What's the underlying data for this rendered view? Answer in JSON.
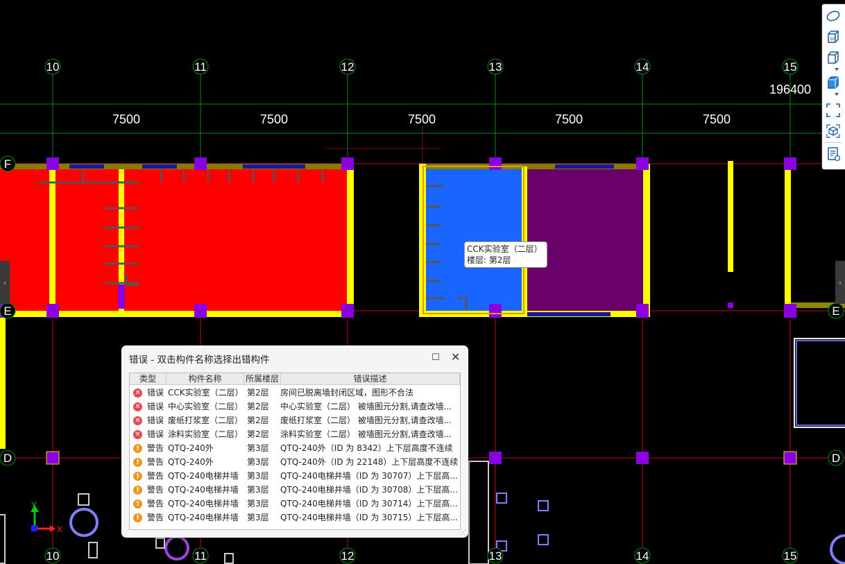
{
  "axes": {
    "columns_top": [
      "10",
      "11",
      "12",
      "13",
      "14",
      "15"
    ],
    "columns_bottom": [
      "10",
      "11",
      "12",
      "13",
      "14",
      "15"
    ],
    "rows_left": [
      "F",
      "E",
      "D"
    ],
    "rows_right": [
      "E",
      "D"
    ]
  },
  "dimensions": {
    "total": "196400",
    "spans": [
      "7500",
      "7500",
      "7500",
      "7500",
      "7500"
    ]
  },
  "tooltip": {
    "name": "CCK实验室（二层）",
    "floor": "楼层: 第2层"
  },
  "dialog": {
    "title": "错误 - 双击构件名称选择出错构件",
    "columns": [
      "类型",
      "构件名称",
      "所属楼层",
      "错误描述"
    ],
    "rows": [
      {
        "level": "error",
        "type": "错误",
        "name": "CCK实验室（二层）",
        "floor": "第2层",
        "desc": "房间已脱离墙封闭区域，图形不合法"
      },
      {
        "level": "error",
        "type": "错误",
        "name": "中心实验室（二层）",
        "floor": "第2层",
        "desc": "中心实验室（二层） 被墙图元分割,请查改墙..."
      },
      {
        "level": "error",
        "type": "错误",
        "name": "废纸打浆室（二层）",
        "floor": "第2层",
        "desc": "废纸打浆室（二层） 被墙图元分割,请查改墙..."
      },
      {
        "level": "error",
        "type": "错误",
        "name": "涂料实验室（二层）",
        "floor": "第2层",
        "desc": "涂料实验室（二层） 被墙图元分割,请查改墙..."
      },
      {
        "level": "warn",
        "type": "警告",
        "name": "QTQ-240外",
        "floor": "第3层",
        "desc": "QTQ-240外（ID 为 8342）上下层高度不连续"
      },
      {
        "level": "warn",
        "type": "警告",
        "name": "QTQ-240外",
        "floor": "第3层",
        "desc": "QTQ-240外（ID 为 22148）上下层高度不连续"
      },
      {
        "level": "warn",
        "type": "警告",
        "name": "QTQ-240电梯井墙",
        "floor": "第3层",
        "desc": "QTQ-240电梯井墙（ID 为 30707）上下层高..."
      },
      {
        "level": "warn",
        "type": "警告",
        "name": "QTQ-240电梯井墙",
        "floor": "第3层",
        "desc": "QTQ-240电梯井墙（ID 为 30708）上下层高..."
      },
      {
        "level": "warn",
        "type": "警告",
        "name": "QTQ-240电梯井墙",
        "floor": "第3层",
        "desc": "QTQ-240电梯井墙（ID 为 30714）上下层高..."
      },
      {
        "level": "warn",
        "type": "警告",
        "name": "QTQ-240电梯井墙",
        "floor": "第3层",
        "desc": "QTQ-240电梯井墙（ID 为 30715）上下层高..."
      }
    ]
  },
  "coord": {
    "y_label": "Y",
    "x_label": "X"
  },
  "toolbar": [
    "view-sphere-icon",
    "view-3d-icon",
    "box-view-icon",
    "solid-box-icon",
    "fit-view-icon",
    "cube-select-icon",
    "report-view-icon"
  ],
  "colors": {
    "room_red": "#ff0000",
    "room_blue": "#1a64ff",
    "room_purple": "#6a006a",
    "wall": "#ffff00",
    "column": "#8a00e0",
    "grid": "#00aa00",
    "axis_line": "#d01010"
  }
}
